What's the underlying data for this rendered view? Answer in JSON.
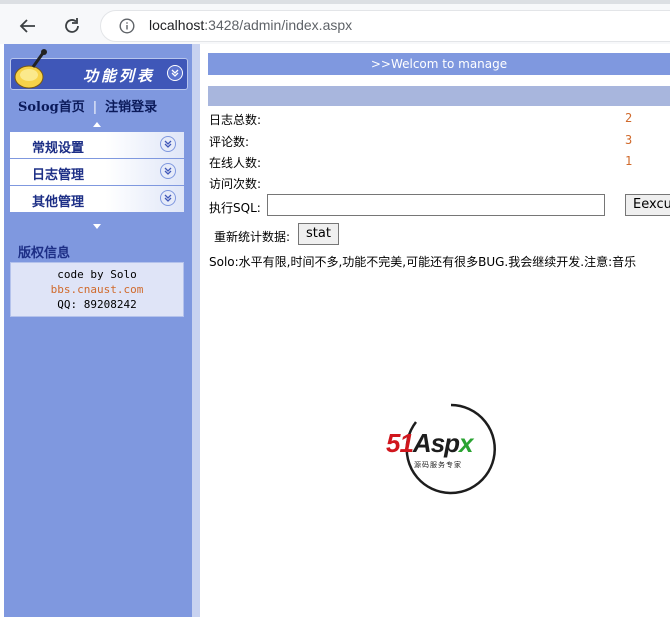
{
  "browser": {
    "url_host": "localhost",
    "url_rest": ":3428/admin/index.aspx",
    "icons": [
      "back-arrow-icon",
      "reload-icon",
      "info-icon"
    ]
  },
  "sidebar": {
    "header_title": "功能列表",
    "nav_home": "Solog首页",
    "nav_separator": "|",
    "nav_logout": "注销登录",
    "menu": [
      {
        "label": "常规设置"
      },
      {
        "label": "日志管理"
      },
      {
        "label": "其他管理"
      }
    ],
    "copyright_head": "版权信息",
    "credit_line1": "code by Solo",
    "credit_line2": "bbs.cnaust.com",
    "credit_line3": "QQ: 89208242"
  },
  "main": {
    "welcome": ">>Welcom to manage",
    "stats": [
      {
        "label": "日志总数:",
        "value": "2"
      },
      {
        "label": "评论数:",
        "value": "3"
      },
      {
        "label": "在线人数:",
        "value": "1"
      },
      {
        "label": "访问次数:",
        "value": ""
      }
    ],
    "sql_label": "执行SQL:",
    "sql_value": "",
    "exec_button": "Eexcute",
    "recount_label": "重新统计数据:",
    "stat_button": "stat",
    "notice": "Solo:水平有限,时间不多,功能不完美,可能还有很多BUG.我会继续开发.注意:音乐"
  },
  "watermark": {
    "brand_51": "51",
    "brand_a": "Asp",
    "brand_x": "x",
    "tagline": "源码服务专家"
  },
  "colors": {
    "sidebar_bg": "#7f98df",
    "header_bg": "#3f57b8",
    "menu_text": "#1d2f86",
    "value_text": "#d06a2c"
  }
}
